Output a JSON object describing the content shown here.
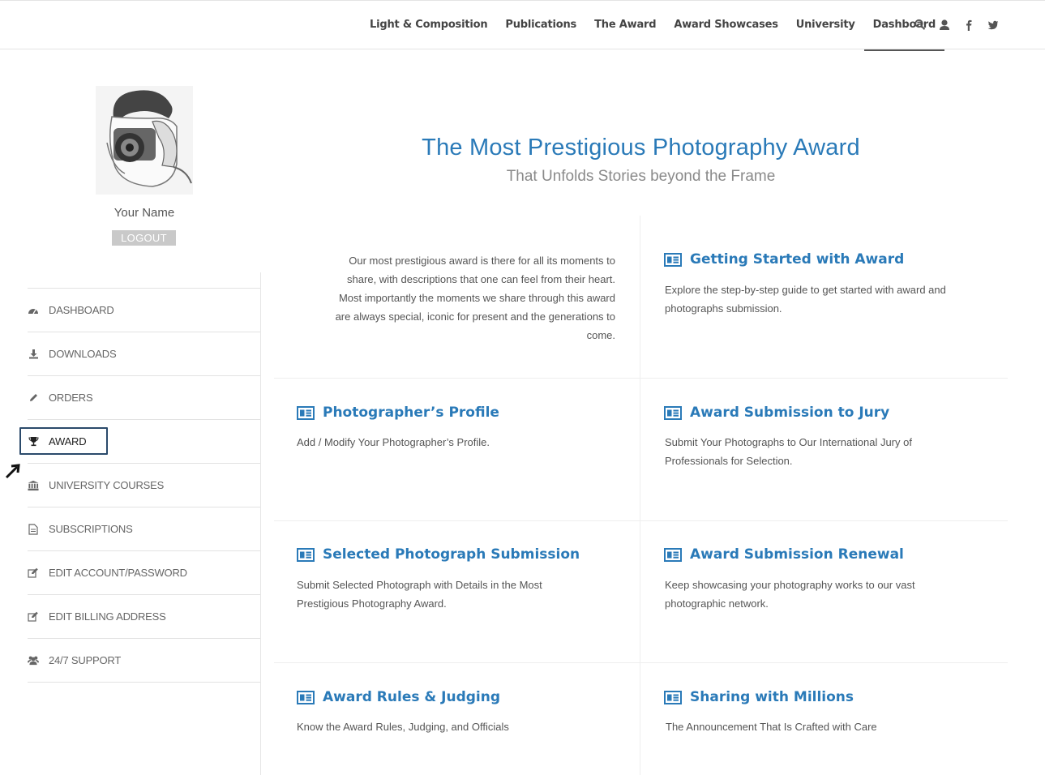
{
  "nav": {
    "items": [
      {
        "label": "Light & Composition"
      },
      {
        "label": "Publications"
      },
      {
        "label": "The Award"
      },
      {
        "label": "Award Showcases"
      },
      {
        "label": "University"
      },
      {
        "label": "Dashboard"
      }
    ],
    "icons": [
      "search-icon",
      "user-icon",
      "facebook-icon",
      "twitter-icon"
    ]
  },
  "profile": {
    "name": "Your Name",
    "logout_label": "LOGOUT"
  },
  "sidebar": {
    "items": [
      {
        "label": "DASHBOARD",
        "icon": "dashboard-icon"
      },
      {
        "label": "DOWNLOADS",
        "icon": "download-icon"
      },
      {
        "label": "ORDERS",
        "icon": "pencil-icon"
      },
      {
        "label": "AWARD",
        "icon": "trophy-icon"
      },
      {
        "label": "UNIVERSITY COURSES",
        "icon": "institution-icon"
      },
      {
        "label": "SUBSCRIPTIONS",
        "icon": "document-icon"
      },
      {
        "label": "EDIT ACCOUNT/PASSWORD",
        "icon": "edit-icon"
      },
      {
        "label": "EDIT BILLING ADDRESS",
        "icon": "edit-icon"
      },
      {
        "label": "24/7 SUPPORT",
        "icon": "users-icon"
      }
    ]
  },
  "hero": {
    "title": "The Most Prestigious Photography Award",
    "subtitle": "That Unfolds Stories beyond the Frame"
  },
  "intro": "Our most prestigious award is there for all its moments to share, with descriptions that one can feel from their heart. Most importantly the moments we share through this award are always special, iconic for present and the generations to come.",
  "cards": [
    {
      "title": "Getting Started with Award",
      "desc": "Explore the step-by-step guide to get started with award and photographs submission."
    },
    {
      "title": "Photographer’s Profile",
      "desc": "Add / Modify Your Photographer’s Profile."
    },
    {
      "title": "Award Submission to Jury",
      "desc": "Submit Your Photographs to Our International Jury of Professionals for Selection."
    },
    {
      "title": "Selected Photograph Submission",
      "desc": "Submit Selected Photograph with Details in the Most Prestigious Photography Award."
    },
    {
      "title": "Award Submission Renewal",
      "desc": "Keep showcasing your photography works to our vast photographic network."
    },
    {
      "title": "Award Rules & Judging",
      "desc": "Know the Award Rules, Judging, and Officials"
    },
    {
      "title": "Sharing with Millions",
      "desc": "The Announcement That Is Crafted with Care"
    }
  ],
  "colors": {
    "accent": "#2a7ab8",
    "active_border": "#2b4a6b",
    "logout_bg": "#c9c9c9"
  }
}
